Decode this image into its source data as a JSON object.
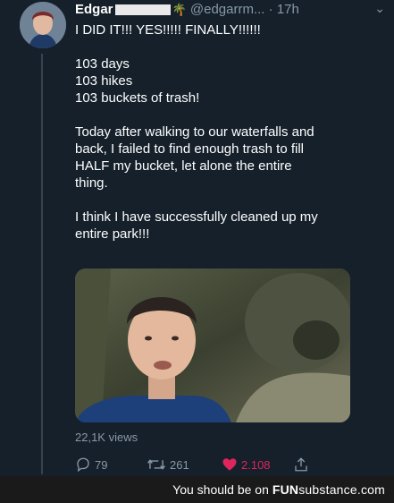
{
  "tweet": {
    "author_name": "Edgar",
    "handle": "@edgarrm...",
    "separator": "·",
    "time": "17h",
    "lines": [
      "I DID IT!!! YES!!!!! FINALLY!!!!!!",
      "",
      "103 days",
      "103 hikes",
      "103 buckets of trash!",
      "",
      "Today after walking to our waterfalls and",
      "back, I failed to find enough trash to fill",
      "HALF my bucket, let alone the entire",
      "thing.",
      "",
      "I think I have successfully cleaned up my",
      "entire park!!!"
    ],
    "views": "22,1K views",
    "replies": "79",
    "retweets": "261",
    "likes": "2.108"
  },
  "icons": {
    "reply": "reply-icon",
    "retweet": "retweet-icon",
    "like": "heart-icon",
    "share": "share-icon",
    "more": "chevron-down-icon",
    "emoji": "palm-tree-icon"
  },
  "colors": {
    "background": "#15202b",
    "secondary_text": "#8899a6",
    "like": "#e0245e",
    "banner": "#1a1a1a"
  },
  "banner": {
    "text": "You should be on",
    "brand_bold": "FUN",
    "brand_rest": "substance",
    "brand_suffix": ".com"
  }
}
